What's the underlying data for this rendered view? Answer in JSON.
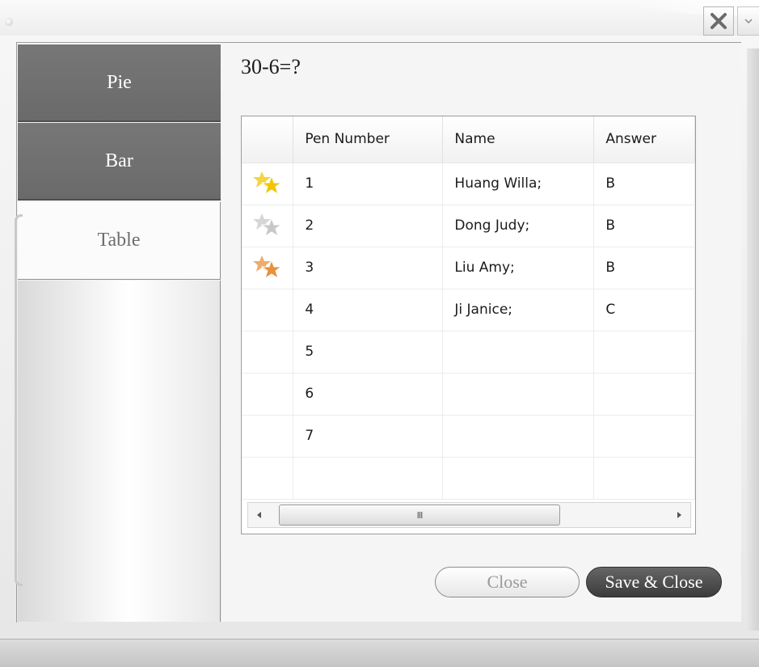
{
  "window": {
    "close_glyph": "✕"
  },
  "sidebar": {
    "tabs": [
      {
        "label": "Pie",
        "selected": false
      },
      {
        "label": "Bar",
        "selected": false
      },
      {
        "label": "Table",
        "selected": true
      }
    ]
  },
  "main": {
    "question": "30-6=?",
    "table": {
      "columns": [
        "",
        "Pen Number",
        "Name",
        "Answer"
      ],
      "rows": [
        {
          "rank_icon": "gold-star-icon",
          "pen": "1",
          "name": "Huang Willa;",
          "answer": "B"
        },
        {
          "rank_icon": "silver-star-icon",
          "pen": "2",
          "name": "Dong Judy;",
          "answer": "B"
        },
        {
          "rank_icon": "bronze-star-icon",
          "pen": "3",
          "name": "Liu Amy;",
          "answer": "B"
        },
        {
          "rank_icon": "",
          "pen": "4",
          "name": "Ji Janice;",
          "answer": "C"
        },
        {
          "rank_icon": "",
          "pen": "5",
          "name": "",
          "answer": ""
        },
        {
          "rank_icon": "",
          "pen": "6",
          "name": "",
          "answer": ""
        },
        {
          "rank_icon": "",
          "pen": "7",
          "name": "",
          "answer": ""
        },
        {
          "rank_icon": "",
          "pen": "",
          "name": "",
          "answer": ""
        }
      ]
    },
    "scrollbar": {
      "grip": "III"
    },
    "buttons": {
      "close_label": "Close",
      "save_close_label": "Save & Close"
    }
  },
  "colors": {
    "gold_star": "#f2c500",
    "silver_star": "#c8c8c8",
    "bronze_star": "#e8903a",
    "dark_tab": "#6f6f6f"
  }
}
